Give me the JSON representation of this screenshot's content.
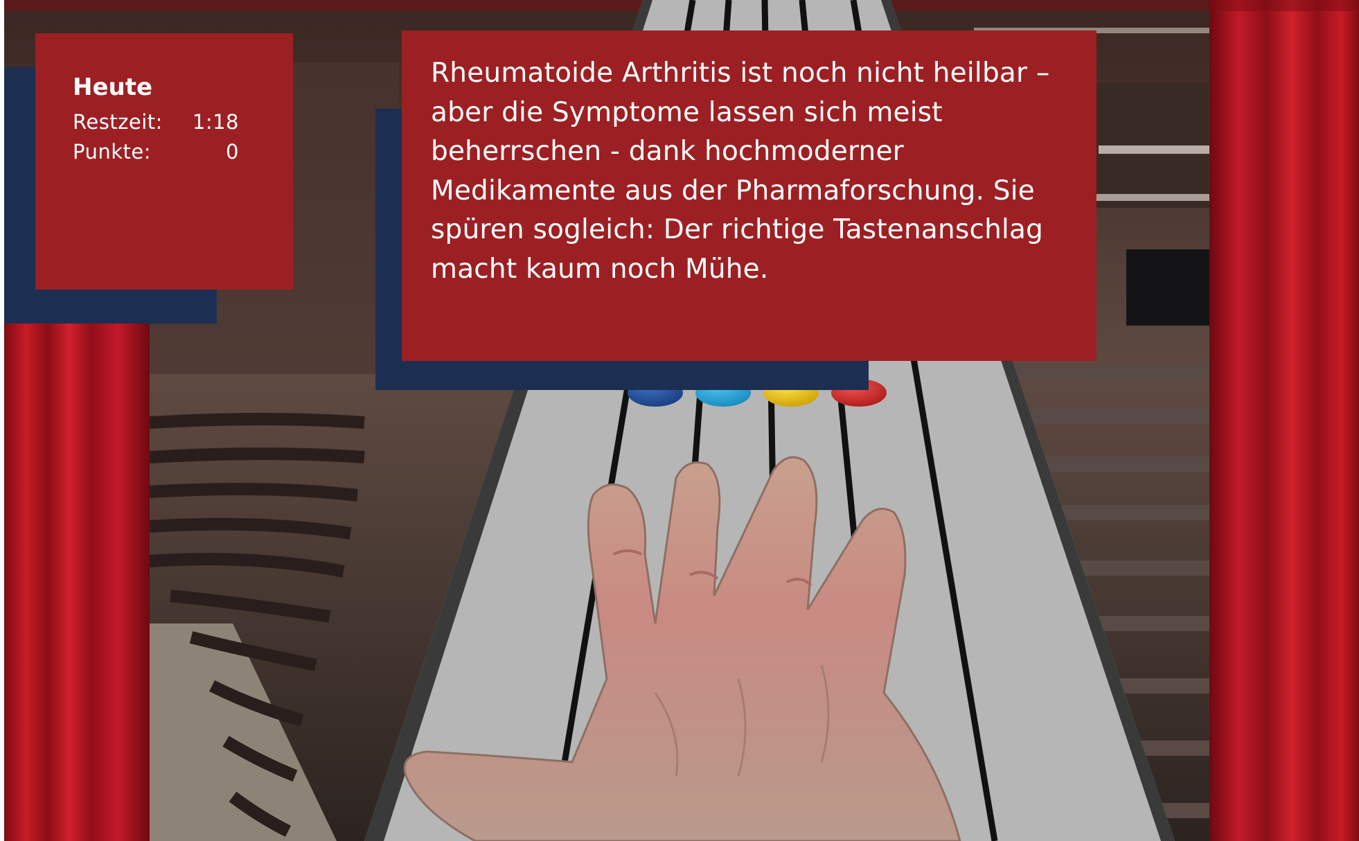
{
  "score": {
    "title": "Heute",
    "time_label": "Restzeit:",
    "time_value": "1:18",
    "points_label": "Punkte:",
    "points_value": "0"
  },
  "message": {
    "text": "Rheumatoide Arthritis ist noch nicht heilbar – aber die Symptome lassen sich meist beherrschen - dank hochmoderner Medikamente aus der Pharmaforschung. Sie spüren sogleich: Der richtige Tastenanschlag macht kaum noch Mühe."
  },
  "game": {
    "lanes": [
      {
        "color": "#1d4a94",
        "name": "blue"
      },
      {
        "color": "#22a6dc",
        "name": "cyan"
      },
      {
        "color": "#f2c400",
        "name": "yellow"
      },
      {
        "color": "#d62b2b",
        "name": "red"
      }
    ]
  },
  "colors": {
    "panel": "#9c2023",
    "panel_shadow": "#1c2f52",
    "curtain": "#b0141e"
  }
}
